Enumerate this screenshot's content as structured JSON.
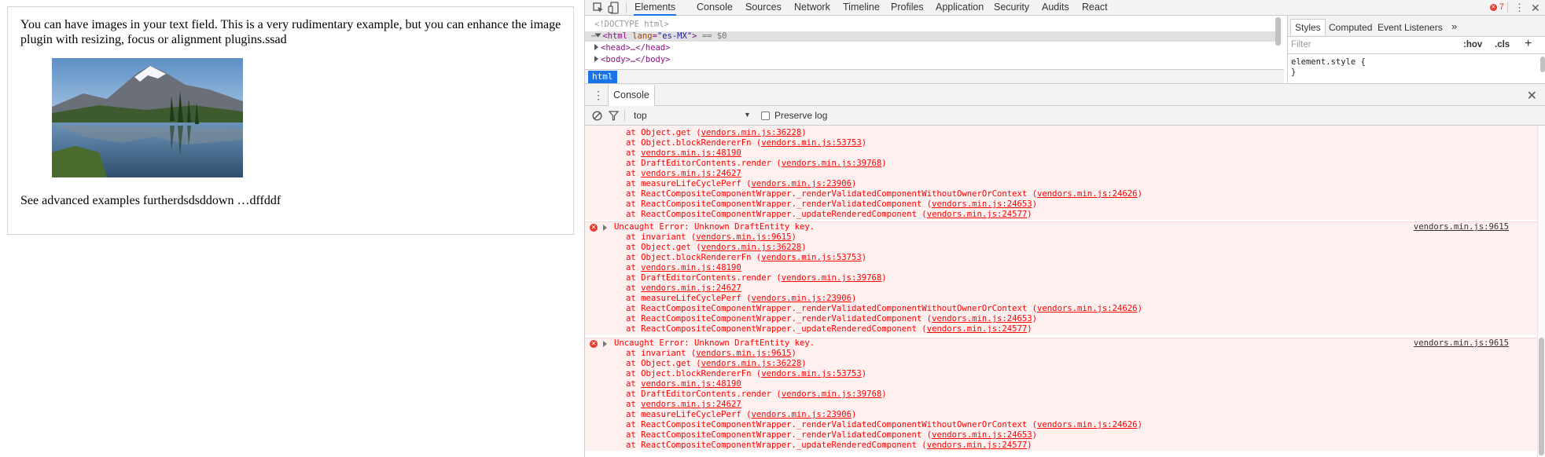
{
  "editor": {
    "paragraph1": "You can have images in your text field. This is a very rudimentary example, but you can enhance the image plugin with resizing, focus or alignment plugins.ssad",
    "paragraph2": "See advanced examples furtherdsdsddown …dffddf",
    "image_alt": "mountain lake landscape"
  },
  "devtools": {
    "tabs": [
      "Elements",
      "Console",
      "Sources",
      "Network",
      "Timeline",
      "Profiles",
      "Application",
      "Security",
      "Audits",
      "React"
    ],
    "active_tab": "Elements",
    "error_count": "7",
    "elements": {
      "doctype": "<!DOCTYPE html>",
      "html_open": "<html",
      "html_attr_name": "lang",
      "html_attr_val": "\"es-MX\"",
      "html_close": ">",
      "html_marker": "== $0",
      "head": "<head>…</head>",
      "body": "<body>…</body>"
    },
    "breadcrumb": "html",
    "styles": {
      "tabs": [
        "Styles",
        "Computed",
        "Event Listeners"
      ],
      "more": "»",
      "filter_placeholder": "Filter",
      "hov": ":hov",
      "cls": ".cls",
      "add": "+",
      "rule_open": "element.style {",
      "rule_close": "}"
    },
    "drawer": {
      "tab": "Console",
      "close": "✕"
    },
    "console_toolbar": {
      "context": "top",
      "preserve_log": "Preserve log"
    },
    "log": {
      "partial_stack": [
        {
          "text": "at Object.get (",
          "link": "vendors.min.js:36228",
          "tail": ")"
        },
        {
          "text": "at Object.blockRendererFn (",
          "link": "vendors.min.js:53753",
          "tail": ")"
        },
        {
          "text": "at ",
          "link": "vendors.min.js:48190",
          "tail": ""
        },
        {
          "text": "at DraftEditorContents.render (",
          "link": "vendors.min.js:39768",
          "tail": ")"
        },
        {
          "text": "at ",
          "link": "vendors.min.js:24627",
          "tail": ""
        },
        {
          "text": "at measureLifeCyclePerf (",
          "link": "vendors.min.js:23906",
          "tail": ")"
        },
        {
          "text": "at ReactCompositeComponentWrapper._renderValidatedComponentWithoutOwnerOrContext (",
          "link": "vendors.min.js:24626",
          "tail": ")"
        },
        {
          "text": "at ReactCompositeComponentWrapper._renderValidatedComponent (",
          "link": "vendors.min.js:24653",
          "tail": ")"
        },
        {
          "text": "at ReactCompositeComponentWrapper._updateRenderedComponent (",
          "link": "vendors.min.js:24577",
          "tail": ")"
        }
      ],
      "error_header": "Uncaught Error: Unknown DraftEntity key.",
      "error_source": "vendors.min.js:9615",
      "full_stack": [
        {
          "text": "at invariant (",
          "link": "vendors.min.js:9615",
          "tail": ")"
        },
        {
          "text": "at Object.get (",
          "link": "vendors.min.js:36228",
          "tail": ")"
        },
        {
          "text": "at Object.blockRendererFn (",
          "link": "vendors.min.js:53753",
          "tail": ")"
        },
        {
          "text": "at ",
          "link": "vendors.min.js:48190",
          "tail": ""
        },
        {
          "text": "at DraftEditorContents.render (",
          "link": "vendors.min.js:39768",
          "tail": ")"
        },
        {
          "text": "at ",
          "link": "vendors.min.js:24627",
          "tail": ""
        },
        {
          "text": "at measureLifeCyclePerf (",
          "link": "vendors.min.js:23906",
          "tail": ")"
        },
        {
          "text": "at ReactCompositeComponentWrapper._renderValidatedComponentWithoutOwnerOrContext (",
          "link": "vendors.min.js:24626",
          "tail": ")"
        },
        {
          "text": "at ReactCompositeComponentWrapper._renderValidatedComponent (",
          "link": "vendors.min.js:24653",
          "tail": ")"
        },
        {
          "text": "at ReactCompositeComponentWrapper._updateRenderedComponent (",
          "link": "vendors.min.js:24577",
          "tail": ")"
        }
      ]
    }
  }
}
